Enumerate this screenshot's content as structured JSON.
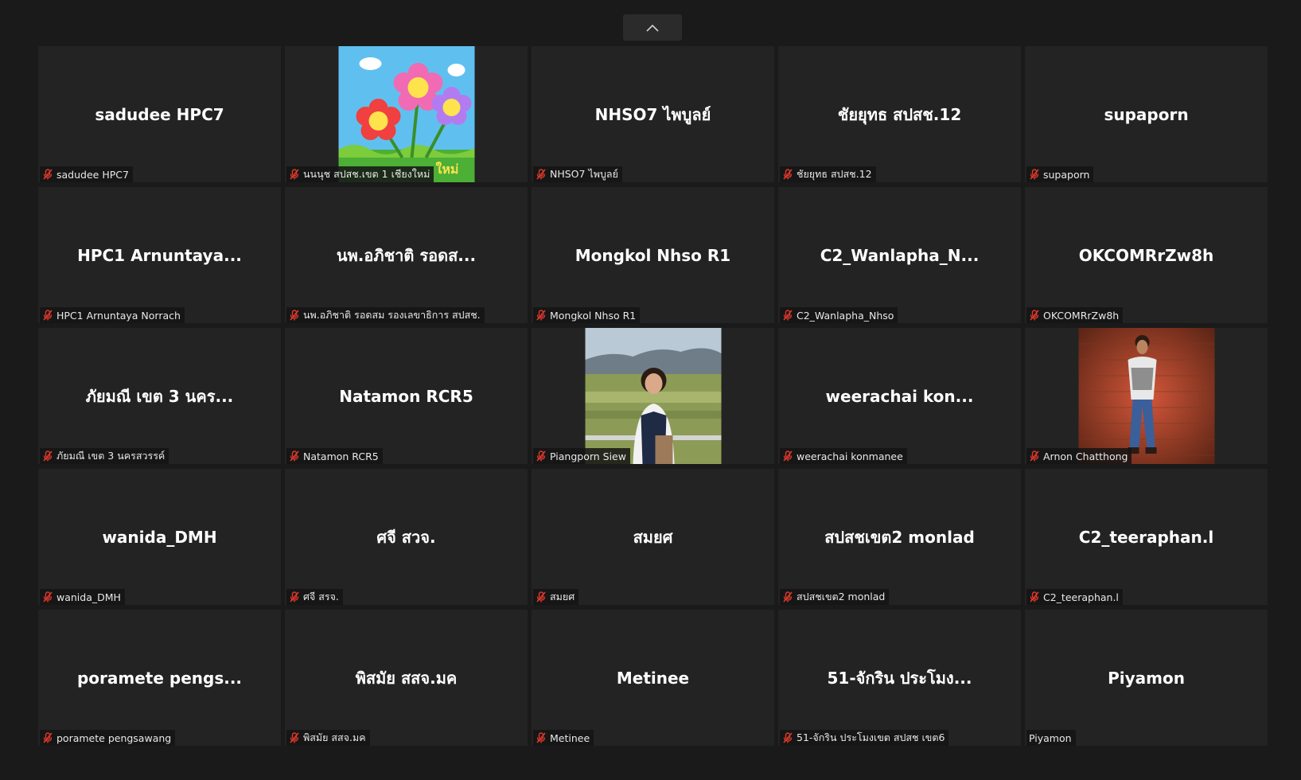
{
  "colors": {
    "muted_icon": "#e0392b",
    "tile_bg": "#232323",
    "page_bg": "#1a1a1a"
  },
  "collapse_icon": "chevron-up-icon",
  "participants": [
    {
      "display": "sadudee HPC7",
      "label": "sadudee HPC7",
      "muted": true,
      "photo": null
    },
    {
      "display": "",
      "label": "นนนุช สปสช.เขต 1 เชียงใหม่",
      "muted": true,
      "photo": "flowers",
      "photo_text": "ใหม่"
    },
    {
      "display": "NHSO7 ไพบูลย์",
      "label": "NHSO7 ไพบูลย์",
      "muted": true,
      "photo": null
    },
    {
      "display": "ชัยยุทธ สปสช.12",
      "label": "ชัยยุทธ สปสช.12",
      "muted": true,
      "photo": null
    },
    {
      "display": "supaporn",
      "label": "supaporn",
      "muted": true,
      "photo": null
    },
    {
      "display": "HPC1 Arnuntaya...",
      "label": "HPC1 Arnuntaya Norrach",
      "muted": true,
      "photo": null
    },
    {
      "display": "นพ.อภิชาติ รอดส...",
      "label": "นพ.อภิชาติ รอดสม รองเลขาธิการ สปสช.",
      "muted": true,
      "photo": null
    },
    {
      "display": "Mongkol Nhso R1",
      "label": "Mongkol Nhso R1",
      "muted": true,
      "photo": null
    },
    {
      "display": "C2_Wanlapha_N...",
      "label": "C2_Wanlapha_Nhso",
      "muted": true,
      "photo": null
    },
    {
      "display": "OKCOMRrZw8h",
      "label": "OKCOMRrZw8h",
      "muted": true,
      "photo": null
    },
    {
      "display": "ภัยมณี เขต 3 นคร...",
      "label": "ภัยมณี เขต 3 นครสวรรค์",
      "muted": true,
      "photo": null
    },
    {
      "display": "Natamon RCR5",
      "label": "Natamon RCR5",
      "muted": true,
      "photo": null
    },
    {
      "display": "",
      "label": "Piangporn Siew",
      "muted": true,
      "photo": "landscape"
    },
    {
      "display": "weerachai kon...",
      "label": "weerachai konmanee",
      "muted": true,
      "photo": null
    },
    {
      "display": "",
      "label": "Arnon Chatthong",
      "muted": true,
      "photo": "brickwall"
    },
    {
      "display": "wanida_DMH",
      "label": "wanida_DMH",
      "muted": true,
      "photo": null
    },
    {
      "display": "ศจี สวจ.",
      "label": "ศจี สรจ.",
      "muted": true,
      "photo": null
    },
    {
      "display": "สมยศ",
      "label": "สมยศ",
      "muted": true,
      "photo": null
    },
    {
      "display": "สปสชเขต2 monlad",
      "label": "สปสชเขต2 monlad",
      "muted": true,
      "photo": null
    },
    {
      "display": "C2_teeraphan.l",
      "label": "C2_teeraphan.l",
      "muted": true,
      "photo": null
    },
    {
      "display": "poramete pengs...",
      "label": "poramete pengsawang",
      "muted": true,
      "photo": null
    },
    {
      "display": "พิสมัย สสจ.มค",
      "label": "พิสมัย สสจ.มค",
      "muted": true,
      "photo": null
    },
    {
      "display": "Metinee",
      "label": "Metinee",
      "muted": true,
      "photo": null
    },
    {
      "display": "51-จักริน ประโมง...",
      "label": "51-จักริน ประโมงเขต สปสช เขต6",
      "muted": true,
      "photo": null
    },
    {
      "display": "Piyamon",
      "label": "Piyamon",
      "muted": false,
      "photo": null
    }
  ]
}
